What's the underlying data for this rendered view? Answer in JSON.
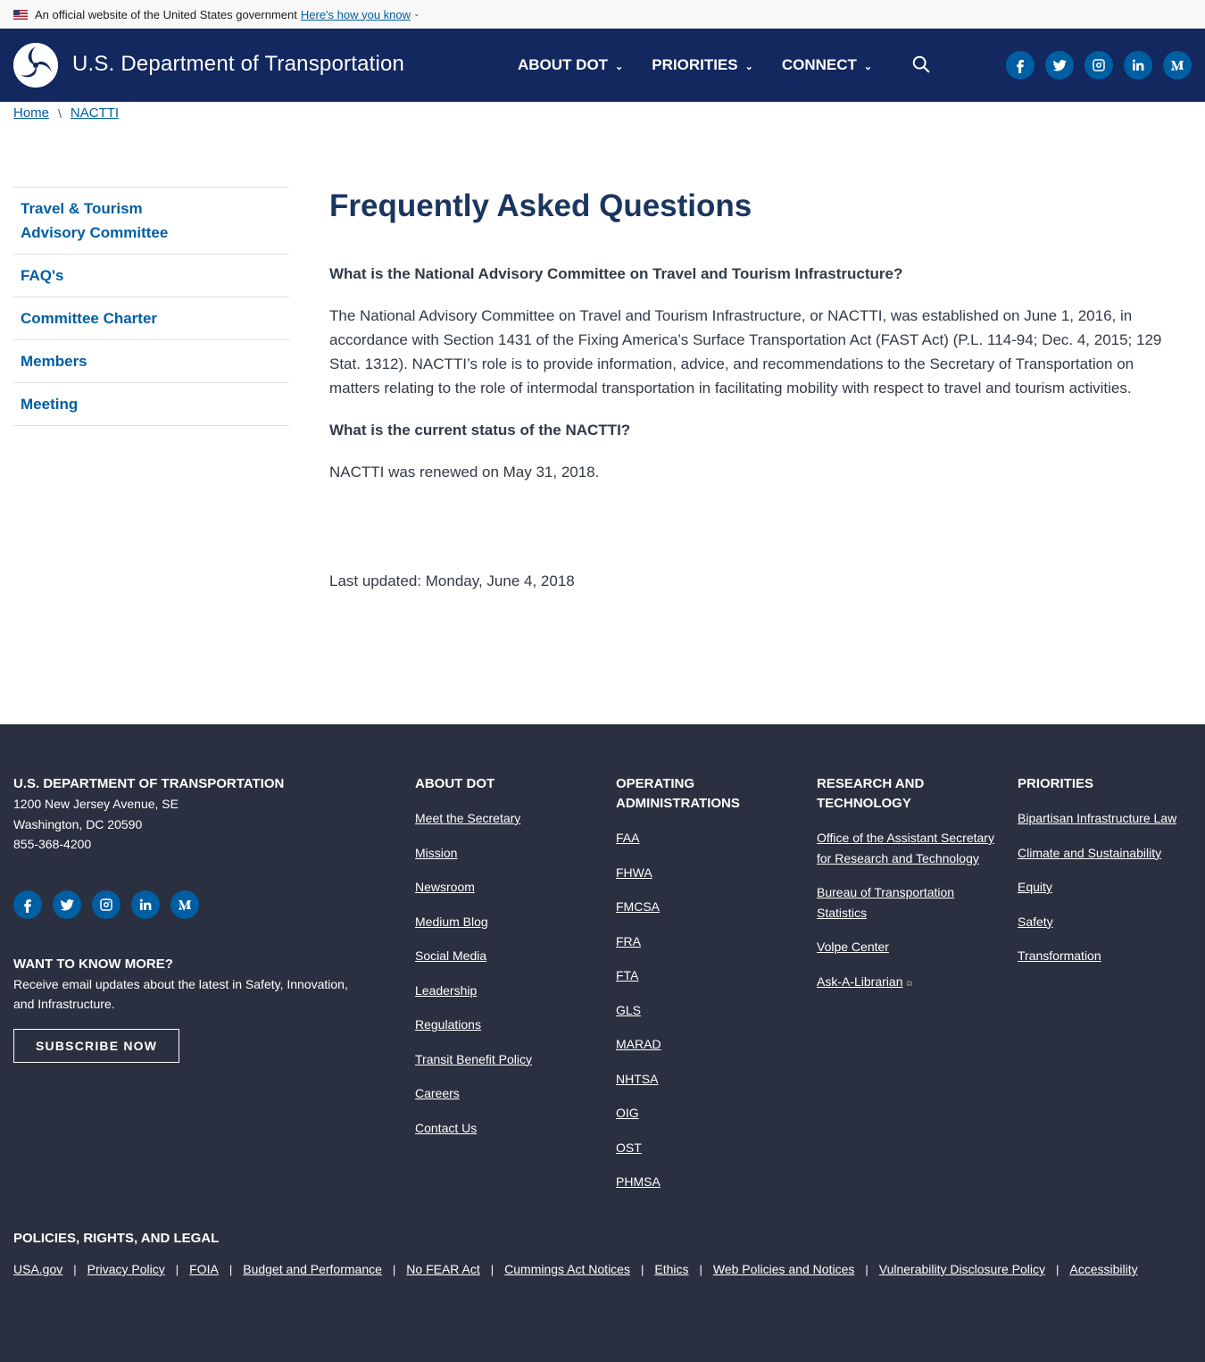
{
  "gov_banner": {
    "text": "An official website of the United States government",
    "link": "Here's how you know",
    "chevron": "⌄"
  },
  "header": {
    "title": "U.S. Department of Transportation",
    "nav": [
      {
        "label": "ABOUT DOT",
        "chevron": "⌄"
      },
      {
        "label": "PRIORITIES",
        "chevron": "⌄"
      },
      {
        "label": "CONNECT",
        "chevron": "⌄"
      }
    ],
    "social": [
      "facebook-icon",
      "twitter-icon",
      "instagram-icon",
      "linkedin-icon",
      "medium-icon"
    ]
  },
  "breadcrumb": {
    "items": [
      "Home",
      "NACTTI"
    ],
    "separator": "\\"
  },
  "sidebar": {
    "items": [
      {
        "label": "Travel & Tourism Advisory Committee"
      },
      {
        "label": "FAQ's"
      },
      {
        "label": "Committee Charter"
      },
      {
        "label": "Members"
      },
      {
        "label": "Meeting"
      }
    ]
  },
  "main": {
    "title": "Frequently Asked Questions",
    "q1": "What is the National Advisory Committee on Travel and Tourism Infrastructure?",
    "a1": "The National Advisory Committee on Travel and Tourism Infrastructure, or NACTTI, was established on June 1, 2016, in accordance with Section 1431 of the Fixing America’s Surface Transportation Act (FAST Act) (P.L. 114-94; Dec. 4, 2015; 129 Stat. 1312).  NACTTI’s role is to provide information, advice, and recommendations to the Secretary of Transportation on matters relating to the role of intermodal transportation in facilitating mobility with respect to travel and tourism activities.",
    "q2": "What is the current status of the NACTTI?",
    "a2": "NACTTI was renewed on May 31, 2018.",
    "last_updated": "Last updated: Monday, June 4, 2018"
  },
  "footer": {
    "org": {
      "title": "U.S. DEPARTMENT OF TRANSPORTATION",
      "address1": "1200 New Jersey Avenue, SE",
      "address2": "Washington, DC 20590",
      "phone": "855-368-4200"
    },
    "want": {
      "title": "WANT TO KNOW MORE?",
      "text": "Receive email updates about the latest in Safety, Innovation, and Infrastructure.",
      "button": "SUBSCRIBE NOW"
    },
    "about": {
      "title": "ABOUT DOT",
      "links": [
        "Meet the Secretary",
        "Mission",
        "Newsroom",
        "Medium Blog",
        "Social Media",
        "Leadership",
        "Regulations",
        "Transit Benefit Policy",
        "Careers",
        "Contact Us"
      ]
    },
    "operating": {
      "title": "OPERATING ADMINISTRATIONS",
      "links": [
        "FAA",
        "FHWA",
        "FMCSA",
        "FRA",
        "FTA",
        "GLS",
        "MARAD",
        "NHTSA",
        "OIG",
        "OST",
        "PHMSA"
      ]
    },
    "research": {
      "title": "RESEARCH AND TECHNOLOGY",
      "links": [
        "Office of the Assistant Secretary for Research and Technology",
        "Bureau of Transportation Statistics",
        "Volpe Center",
        "Ask-A-Librarian"
      ],
      "external_icon": "⧉"
    },
    "priorities": {
      "title": "PRIORITIES",
      "links": [
        "Bipartisan Infrastructure Law",
        "Climate and Sustainability",
        "Equity",
        "Safety",
        "Transformation"
      ]
    },
    "legal": {
      "title": "POLICIES, RIGHTS, AND LEGAL",
      "links": [
        "USA.gov",
        "Privacy Policy",
        "FOIA",
        "Budget and Performance",
        "No FEAR Act",
        "Cummings Act Notices",
        "Ethics",
        "Web Policies and Notices",
        "Vulnerability Disclosure Policy",
        "Accessibility"
      ],
      "separator": "|"
    }
  },
  "colors": {
    "header_bg": "#12285f",
    "link": "#005ea2",
    "title": "#1a3660",
    "footer_bg": "#2a303f"
  }
}
